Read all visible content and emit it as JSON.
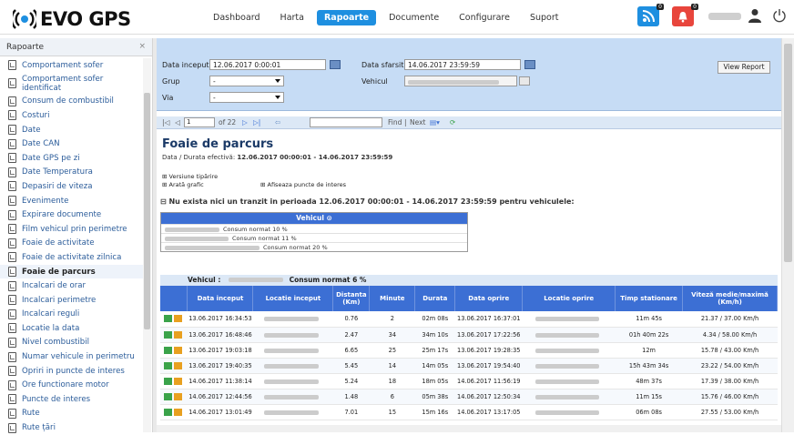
{
  "app": {
    "logo_text": "EVO GPS"
  },
  "nav": [
    "Dashboard",
    "Harta",
    "Rapoarte",
    "Documente",
    "Configurare",
    "Suport"
  ],
  "nav_active": "Rapoarte",
  "top": {
    "rss_badge": "0",
    "alert_badge": "0"
  },
  "colors": {
    "accent": "#1e8fe0",
    "alert": "#e8453c",
    "header_blue": "#3c6fd4",
    "param_bg": "#c6dcf5"
  },
  "sidebar": {
    "title": "Rapoarte",
    "close": "×",
    "items": [
      "Comportament sofer",
      "Comportament sofer identificat",
      "Consum de combustibil",
      "Costuri",
      "Date",
      "Date CAN",
      "Date GPS pe zi",
      "Date Temperatura",
      "Depasiri de viteza",
      "Evenimente",
      "Expirare documente",
      "Film vehicul prin perimetre",
      "Foaie de activitate",
      "Foaie de activitate zilnica",
      "Foaie de parcurs",
      "Incalcari de orar",
      "Incalcari perimetre",
      "Incalcari reguli",
      "Locatie la data",
      "Nivel combustibil",
      "Numar vehicule in perimetru",
      "Opriri in puncte de interes",
      "Ore functionare motor",
      "Puncte de interes",
      "Rute",
      "Rute țări"
    ],
    "active": "Foaie de parcurs"
  },
  "params": {
    "start_label": "Data inceput",
    "start_value": "12.06.2017 0:00:01",
    "end_label": "Data sfarsit",
    "end_value": "14.06.2017 23:59:59",
    "group_label": "Grup",
    "group_value": "-",
    "vehicle_label": "Vehicul",
    "via_label": "Via",
    "via_value": "-",
    "view_button": "View Report"
  },
  "toolbar": {
    "page": "1",
    "of": "of 22",
    "find": "Find",
    "next": "Next"
  },
  "report": {
    "title": "Foaie de parcurs",
    "subtitle_prefix": "Data / Durata efectivă: ",
    "subtitle_value": "12.06.2017 00:00:01 - 14.06.2017 23:59:59",
    "opt1": "⊞ Versiune tipărire",
    "opt2": "⊞ Arată grafic",
    "opt3": "⊞ Afiseaza puncte de interes",
    "warning": "⊟ Nu exista nici un tranzit in perioada 12.06.2017 00:00:01 - 14.06.2017 23:59:59 pentru vehiculele:",
    "vehicles_header": "Vehicul",
    "vehicles": [
      "Consum normat 10 %",
      "Consum normat 11 %",
      "Consum normat 20 %"
    ],
    "group_vehicle_label": "Vehicul :",
    "group_consum": "Consum normat 6 %"
  },
  "table": {
    "headers": [
      "Data inceput",
      "Locatie inceput",
      "Distanta (Km)",
      "Minute",
      "Durata",
      "Data oprire",
      "Locatie oprire",
      "Timp stationare",
      "Viteză medie/maximă (Km/h)"
    ],
    "rows": [
      [
        "13.06.2017 16:34:53",
        "0.76",
        "2",
        "02m 08s",
        "13.06.2017 16:37:01",
        "11m 45s",
        "21.37 / 37.00 Km/h"
      ],
      [
        "13.06.2017 16:48:46",
        "2.47",
        "34",
        "34m 10s",
        "13.06.2017 17:22:56",
        "01h 40m 22s",
        "4.34 / 58.00 Km/h"
      ],
      [
        "13.06.2017 19:03:18",
        "6.65",
        "25",
        "25m 17s",
        "13.06.2017 19:28:35",
        "12m",
        "15.78 / 43.00 Km/h"
      ],
      [
        "13.06.2017 19:40:35",
        "5.45",
        "14",
        "14m 05s",
        "13.06.2017 19:54:40",
        "15h 43m 34s",
        "23.22 / 54.00 Km/h"
      ],
      [
        "14.06.2017 11:38:14",
        "5.24",
        "18",
        "18m 05s",
        "14.06.2017 11:56:19",
        "48m 37s",
        "17.39 / 38.00 Km/h"
      ],
      [
        "14.06.2017 12:44:56",
        "1.48",
        "6",
        "05m 38s",
        "14.06.2017 12:50:34",
        "11m 15s",
        "15.76 / 46.00 Km/h"
      ],
      [
        "14.06.2017 13:01:49",
        "7.01",
        "15",
        "15m 16s",
        "14.06.2017 13:17:05",
        "06m 08s",
        "27.55 / 53.00 Km/h"
      ]
    ]
  }
}
